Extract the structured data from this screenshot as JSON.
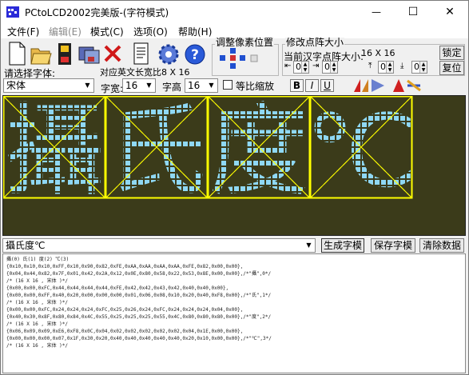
{
  "window": {
    "title": "PCtoLCD2002完美版-(字符模式)",
    "controls": {
      "minimize": "—",
      "maximize": "☐",
      "close": "✕"
    }
  },
  "menu": [
    {
      "label": "文件(F)",
      "disabled": false
    },
    {
      "label": "编辑(E)",
      "disabled": true
    },
    {
      "label": "模式(C)",
      "disabled": false
    },
    {
      "label": "选项(O)",
      "disabled": false
    },
    {
      "label": "帮助(H)",
      "disabled": false
    }
  ],
  "toolbar": {
    "icons": [
      "new-file-icon",
      "open-folder-icon",
      "save-icon",
      "save-as-icon",
      "delete-icon",
      "document-icon",
      "settings-gear-icon",
      "help-icon"
    ]
  },
  "pixel_adjust": {
    "title": "调整像素位置"
  },
  "dot_size": {
    "title": "修改点阵大小",
    "subtitle": "当前汉字点阵大小:",
    "current": "16 X 16",
    "lock_label": "锁定",
    "restore_label": "复位",
    "spinners": [
      "0",
      "0",
      "0",
      "0"
    ]
  },
  "font": {
    "select_label": "请选择字体:",
    "select_value": "宋体",
    "en_width_label": "对应英文长宽比8 X 16",
    "width_label": "字宽:",
    "width_value": "16",
    "height_label": "字高",
    "height_value": "16",
    "proportional_label": "等比缩放",
    "proportional_checked": false,
    "bold": "B",
    "italic": "I",
    "underline": "U"
  },
  "preview": {
    "characters": [
      "攝",
      "氏",
      "度",
      "℃"
    ],
    "cell_colors": {
      "background": "#3b3b1a",
      "grid": "#5a5a30",
      "pixel": "#8fd8f4",
      "box": "#ffff00"
    }
  },
  "input": {
    "text": "攝氏度℃",
    "generate_label": "生成字模",
    "save_label": "保存字模",
    "clear_label": "清除数据"
  },
  "output": {
    "lines": [
      "攝(0) 氏(1) 度(2) ℃(3)",
      "",
      "{0x10,0x10,0x10,0xFF,0x10,0x90,0x82,0xFE,0xAA,0xAA,0xAA,0xAA,0xFE,0x82,0x00,0x00},",
      "{0x04,0x44,0x82,0x7F,0x01,0x42,0x2A,0x12,0x0E,0x80,0x58,0x22,0x53,0x8E,0x00,0x00},/*\"攝\",0*/",
      "/* (16 X 16 , 宋体 )*/",
      "{0x00,0x00,0xFC,0x44,0x44,0x44,0x44,0xFE,0x42,0x42,0x43,0x42,0x40,0x40,0x00},",
      "{0x00,0x00,0xFF,0x40,0x20,0x00,0x00,0x00,0x01,0x06,0x08,0x10,0x20,0x40,0xF8,0x00},/*\"氏\",1*/",
      "/* (16 X 16 , 宋体 )*/",
      "{0x00,0x00,0xFC,0x24,0x24,0x24,0xFC,0x25,0x26,0x24,0xFC,0x24,0x24,0x24,0x04,0x00},",
      "{0x40,0x30,0x8F,0x80,0x84,0x4C,0x55,0x25,0x25,0x25,0x55,0x4C,0x80,0x80,0x80,0x00},/*\"度\",2*/",
      "/* (16 X 16 , 宋体 )*/",
      "{0x06,0x09,0x09,0xE6,0xF8,0x0C,0x04,0x02,0x02,0x02,0x02,0x02,0x04,0x1E,0x00,0x00},",
      "{0x00,0x00,0x00,0x07,0x1F,0x30,0x20,0x40,0x40,0x40,0x40,0x40,0x20,0x10,0x00,0x00},/*\"℃\",3*/",
      "/* (16 X 16 , 宋体 )*/"
    ]
  }
}
